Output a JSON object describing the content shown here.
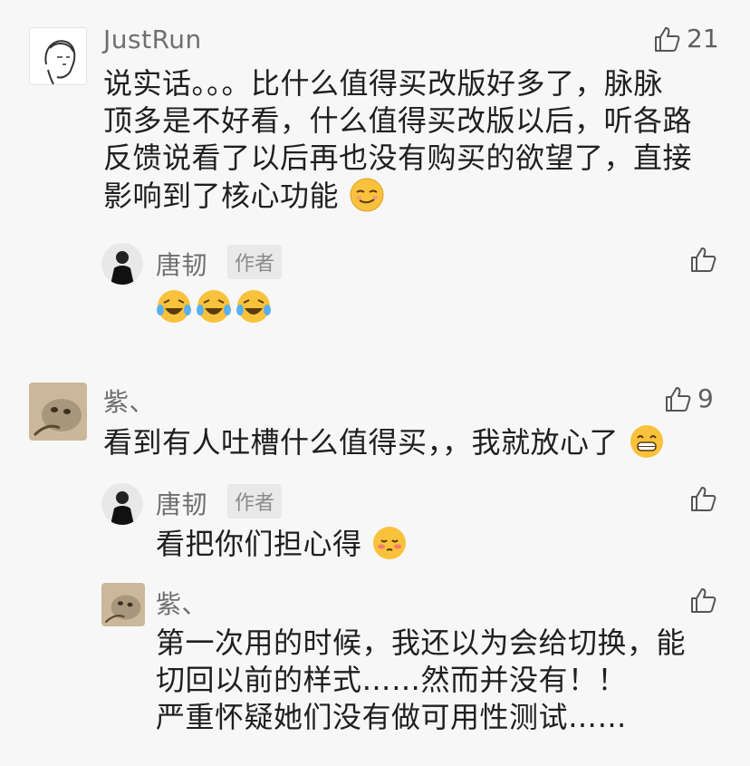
{
  "comments": [
    {
      "name": "JustRun",
      "likes": "21",
      "lines": [
        "说实话。。。比什么值得买改版好多了，脉脉",
        "顶多是不好看，什么值得买改版以后，听各路",
        "反馈说看了以后再也没有购买的欲望了，直接",
        "影响到了核心功能"
      ],
      "emoji": "smirk-emoji",
      "reply": {
        "name": "唐韧",
        "tag": "作者",
        "emojis": [
          "laugh-cry-emoji",
          "laugh-cry-emoji",
          "laugh-cry-emoji"
        ]
      }
    },
    {
      "name": "紫、",
      "likes": "9",
      "text": "看到有人吐槽什么值得买，，我就放心了",
      "emoji": "grin-emoji",
      "replies": [
        {
          "name": "唐韧",
          "tag": "作者",
          "text": "看把你们担心得",
          "emoji": "blush-emoji"
        },
        {
          "name": "紫、",
          "lines": [
            "第一次用的时候，我还以为会给切换，能",
            "切回以前的样式……然而并没有！！",
            "严重怀疑她们没有做可用性测试……"
          ]
        }
      ]
    }
  ],
  "colors": {
    "background": "#f7f7f7",
    "name": "#6f6f6f",
    "text": "#1f1f1f",
    "tag_bg": "#e9e9e9"
  }
}
